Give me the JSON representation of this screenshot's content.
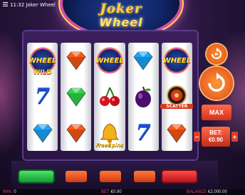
{
  "topbar": {
    "time_title": "11:32 Joker Wheel"
  },
  "logo": {
    "line1": "Joker",
    "line2": "Wheel"
  },
  "reels": [
    [
      {
        "type": "wheel",
        "label": "WILD",
        "text": "WHEEL"
      },
      {
        "type": "seven"
      },
      {
        "type": "diamond",
        "color": "#1aa8ff"
      }
    ],
    [
      {
        "type": "diamond",
        "color": "#ff5a14"
      },
      {
        "type": "diamond",
        "color": "#2ed84a"
      },
      {
        "type": "diamond",
        "color": "#ff5a14"
      }
    ],
    [
      {
        "type": "wheel",
        "text": "WHEEL"
      },
      {
        "type": "cherry"
      },
      {
        "type": "bell",
        "label": "FreeSpins"
      }
    ],
    [
      {
        "type": "diamond",
        "color": "#1aa8ff"
      },
      {
        "type": "plum"
      },
      {
        "type": "seven"
      }
    ],
    [
      {
        "type": "wheel",
        "text": "WHEEL"
      },
      {
        "type": "scatter",
        "label": "SCATTER"
      },
      {
        "type": "diamond",
        "color": "#ff5a14"
      }
    ]
  ],
  "seven_glyph": "7",
  "controls": {
    "max_label": "MAX",
    "bet_label": "BET:",
    "bet_value": "€0.90",
    "decrease": "−",
    "increase": "+"
  },
  "status": {
    "win_label": "WIN:",
    "win_value": "0",
    "bet_label": "BET",
    "bet_value": "€0.90",
    "balance_label": "BALANCE",
    "balance_value": "€2,000.00"
  }
}
